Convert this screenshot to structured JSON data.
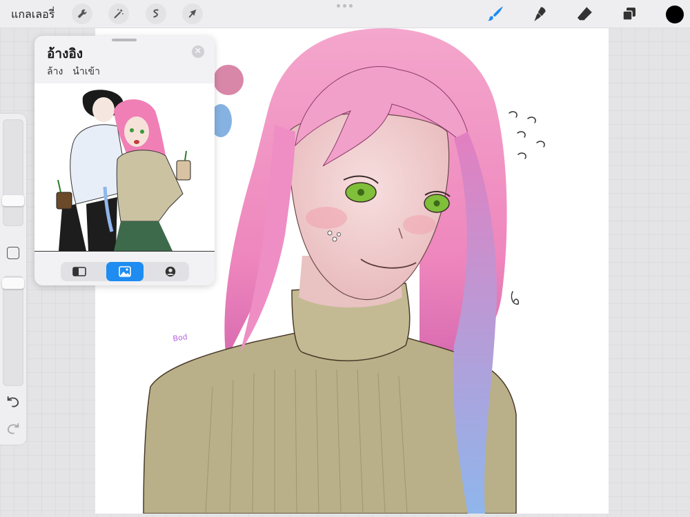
{
  "topbar": {
    "gallery_label": "แกลเลอรี่",
    "left_tools": [
      "wrench-icon",
      "magic-wand-icon",
      "selection-icon",
      "transform-arrow-icon"
    ],
    "right_tools": [
      "brush-icon",
      "smudge-icon",
      "eraser-icon",
      "layers-icon"
    ],
    "active_tool": "brush-icon",
    "accent_color": "#1e8cf0",
    "current_color": "#000000"
  },
  "reference_panel": {
    "title": "อ้างอิง",
    "clear_label": "ล้าง",
    "import_label": "นำเข้า",
    "modes": [
      "canvas-mode-icon",
      "image-mode-icon",
      "face-mode-icon"
    ],
    "active_mode": "image-mode-icon"
  },
  "sidebar": {
    "brush_size_level": 0.28,
    "opacity_level": 0.05
  },
  "canvas": {
    "signature_text": "Bod",
    "background_color": "#ffffff"
  }
}
